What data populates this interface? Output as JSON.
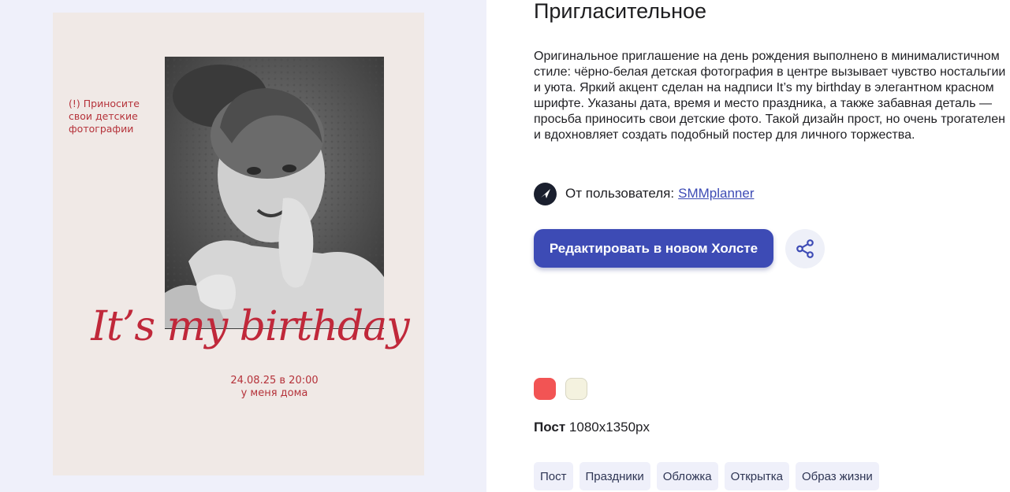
{
  "template": {
    "title": "Пригласительное",
    "description": "Оригинальное приглашение на день рождения выполнено в минималистичном стиле: чёрно-белая детская фотография в центре вызывает чувство ностальгии и уюта. Яркий акцент сделан на надписи It’s my birthday в элегантном красном шрифте. Указаны дата, время и место праздника, а также забавная деталь — просьба приносить свои детские фото. Такой дизайн прост, но очень трогателен и вдохновляет создать подобный постер для личного торжества.",
    "author_prefix": "От пользователя:",
    "author_name": "SMMplanner",
    "edit_button": "Редактировать в новом Холсте",
    "format_label": "Пост",
    "format_size": "1080x1350px",
    "colors": [
      "#f25454",
      "#f4f2df"
    ],
    "tags": [
      "Пост",
      "Праздники",
      "Обложка",
      "Открытка",
      "Образ жизни"
    ]
  },
  "poster": {
    "note": "(!) Приносите свои детские фотографии",
    "headline": "It’s my birthday",
    "date_time": "24.08.25 в 20:00",
    "place": "у меня дома",
    "accent_color": "#c0283a"
  }
}
